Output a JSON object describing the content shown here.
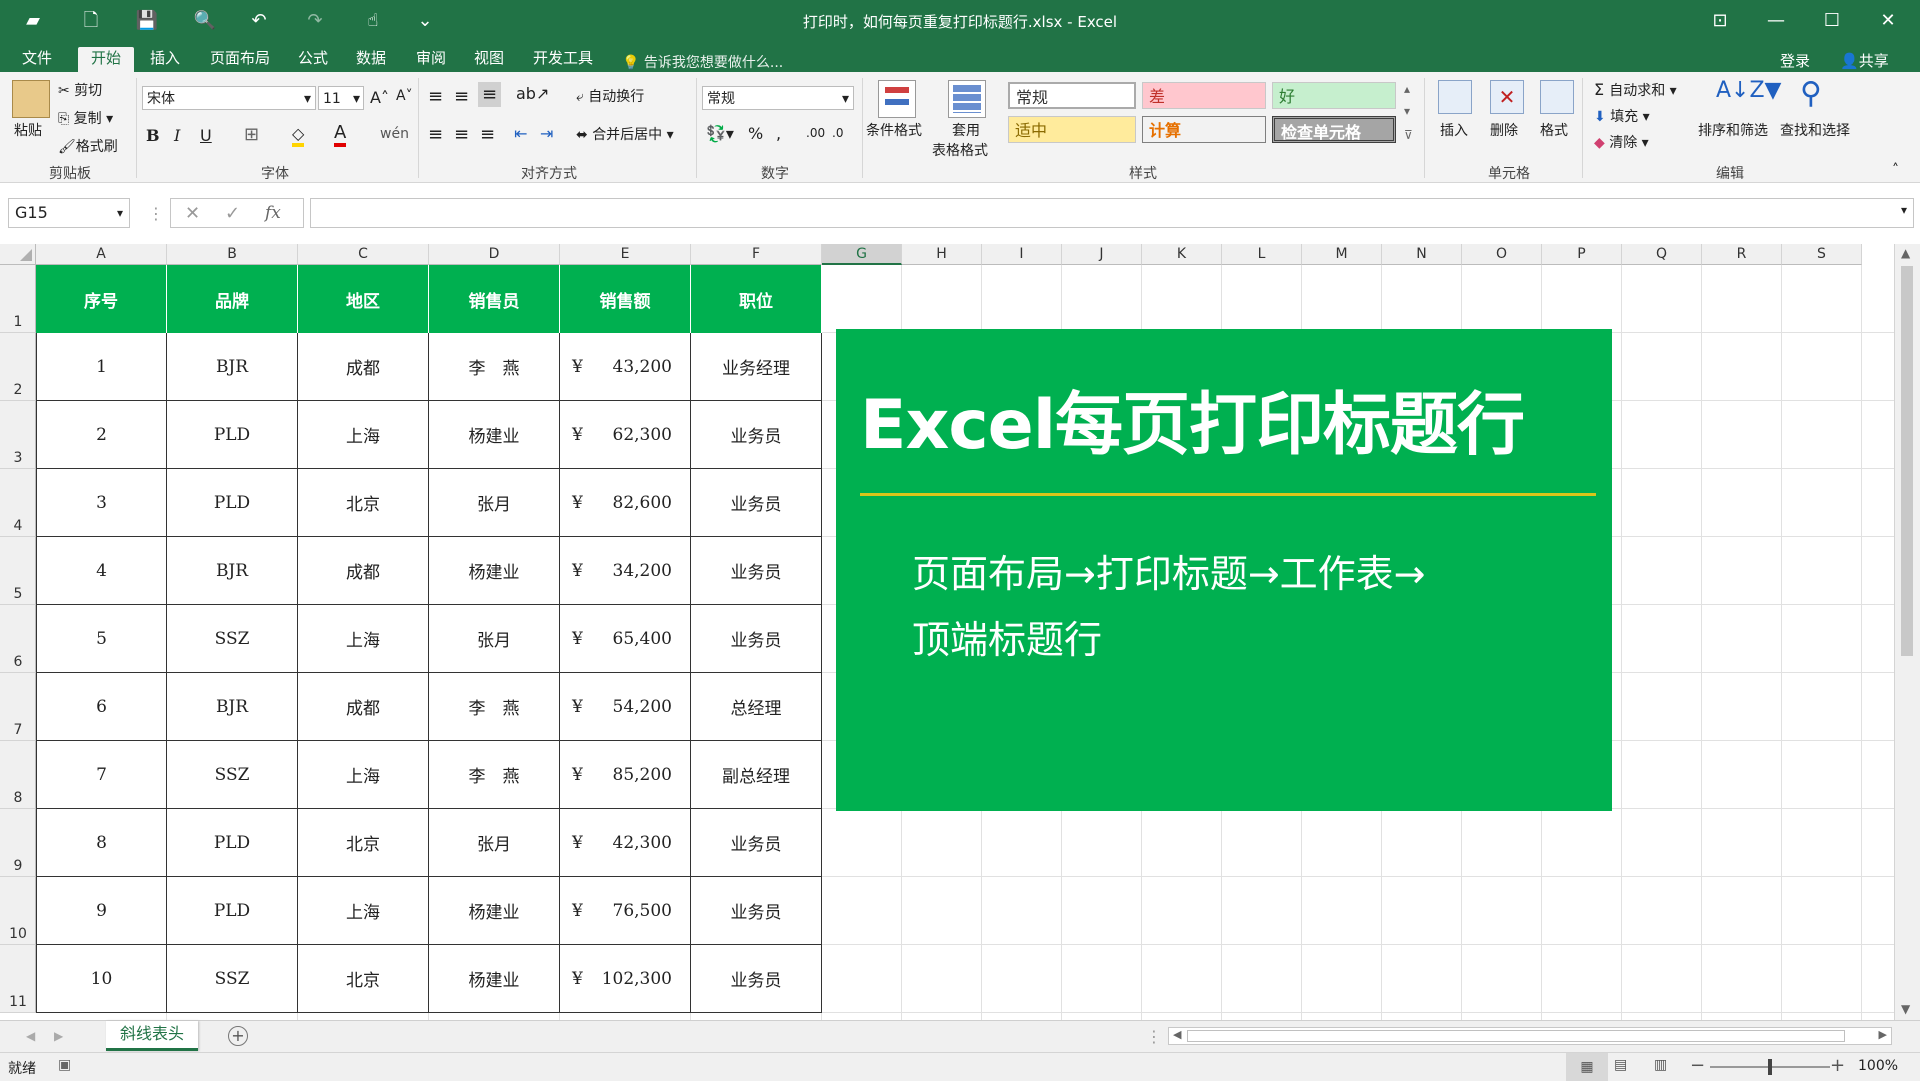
{
  "window": {
    "title": "打印时，如何每页重复打印标题行.xlsx - Excel",
    "restore_icon": "ribbon-display-icon",
    "minimize": "—",
    "maximize": "☐",
    "close": "✕"
  },
  "ribbon_tabs": [
    "文件",
    "开始",
    "插入",
    "页面布局",
    "公式",
    "数据",
    "审阅",
    "视图",
    "开发工具"
  ],
  "tell_me": "告诉我您想要做什么...",
  "account": {
    "login": "登录",
    "share": "共享"
  },
  "clipboard": {
    "paste": "粘贴",
    "cut": "剪切",
    "copy": "复制",
    "format_painter": "格式刷",
    "label": "剪贴板"
  },
  "font": {
    "name": "宋体",
    "size": "11",
    "label": "字体"
  },
  "alignment": {
    "wrap": "自动换行",
    "merge": "合并后居中",
    "label": "对齐方式"
  },
  "number": {
    "format": "常规",
    "label": "数字"
  },
  "styles": {
    "cond_format": "条件格式",
    "table_format_1": "套用",
    "table_format_2": "表格格式",
    "cells": [
      "常规",
      "差",
      "好",
      "适中",
      "计算",
      "检查单元格"
    ],
    "label": "样式"
  },
  "cells_group": {
    "insert": "插入",
    "delete": "删除",
    "format": "格式",
    "label": "单元格"
  },
  "editing": {
    "autosum": "自动求和",
    "fill": "填充",
    "clear": "清除",
    "sort": "排序和筛选",
    "find": "查找和选择",
    "label": "编辑"
  },
  "formula_bar": {
    "name_box": "G15",
    "fx": "fx",
    "value": ""
  },
  "columns": [
    "A",
    "B",
    "C",
    "D",
    "E",
    "F",
    "G",
    "H",
    "I",
    "J",
    "K",
    "L",
    "M",
    "N",
    "O",
    "P",
    "Q",
    "R",
    "S"
  ],
  "rows": [
    "1",
    "2",
    "3",
    "4",
    "5",
    "6",
    "7",
    "8",
    "9",
    "10",
    "11"
  ],
  "table": {
    "headers": [
      "序号",
      "品牌",
      "地区",
      "销售员",
      "销售额",
      "职位"
    ],
    "currency": "¥",
    "rows": [
      [
        "1",
        "BJR",
        "成都",
        "李　燕",
        "43,200",
        "业务经理"
      ],
      [
        "2",
        "PLD",
        "上海",
        "杨建业",
        "62,300",
        "业务员"
      ],
      [
        "3",
        "PLD",
        "北京",
        "张月",
        "82,600",
        "业务员"
      ],
      [
        "4",
        "BJR",
        "成都",
        "杨建业",
        "34,200",
        "业务员"
      ],
      [
        "5",
        "SSZ",
        "上海",
        "张月",
        "65,400",
        "业务员"
      ],
      [
        "6",
        "BJR",
        "成都",
        "李　燕",
        "54,200",
        "总经理"
      ],
      [
        "7",
        "SSZ",
        "上海",
        "李　燕",
        "85,200",
        "副总经理"
      ],
      [
        "8",
        "PLD",
        "北京",
        "张月",
        "42,300",
        "业务员"
      ],
      [
        "9",
        "PLD",
        "上海",
        "杨建业",
        "76,500",
        "业务员"
      ],
      [
        "10",
        "SSZ",
        "北京",
        "杨建业",
        "102,300",
        "业务员"
      ]
    ]
  },
  "card": {
    "title": "Excel每页打印标题行",
    "line1": "页面布局→打印标题→工作表→",
    "line2": "顶端标题行"
  },
  "sheet_tab": "斜线表头",
  "status": {
    "ready": "就绪",
    "zoom": "100%"
  },
  "colors": {
    "excel_green": "#217346",
    "table_green": "#00b050",
    "accent_line": "#d9c51a"
  }
}
